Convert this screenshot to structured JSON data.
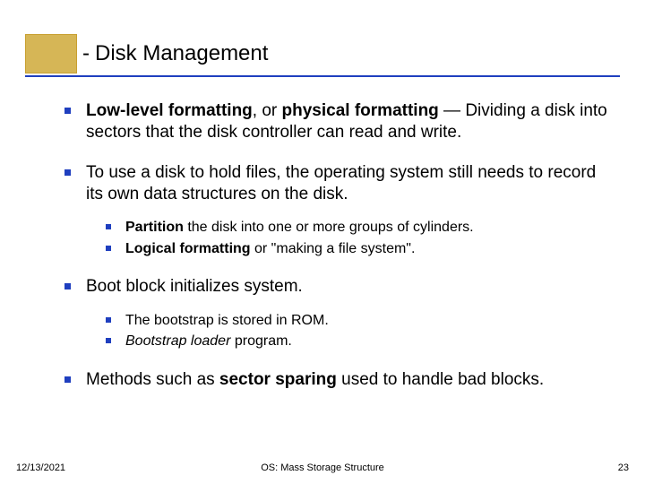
{
  "header": {
    "dash": "-",
    "title": "Disk Management"
  },
  "bullets": {
    "p1": {
      "b1": "Low-level formatting",
      "t1": ", or ",
      "b2": "physical formatting",
      "t2": " — Dividing a disk into sectors that the disk controller can read and write."
    },
    "p2": {
      "t1": "To use a disk to hold files, the operating system still needs to record its own data structures on the disk.",
      "sub": {
        "s1b": "Partition",
        "s1t": " the disk into one or more groups of cylinders.",
        "s2b": "Logical formatting",
        "s2t": " or \"making a file system\"."
      }
    },
    "p3": {
      "t1": "Boot block initializes system.",
      "sub": {
        "s1": "The bootstrap is stored in ROM.",
        "s2i": "Bootstrap loader",
        "s2t": " program."
      }
    },
    "p4": {
      "t1": "Methods such as ",
      "b1": "sector sparing",
      "t2": " used to handle bad blocks."
    }
  },
  "footer": {
    "date": "12/13/2021",
    "center": "OS: Mass Storage Structure",
    "page": "23"
  }
}
